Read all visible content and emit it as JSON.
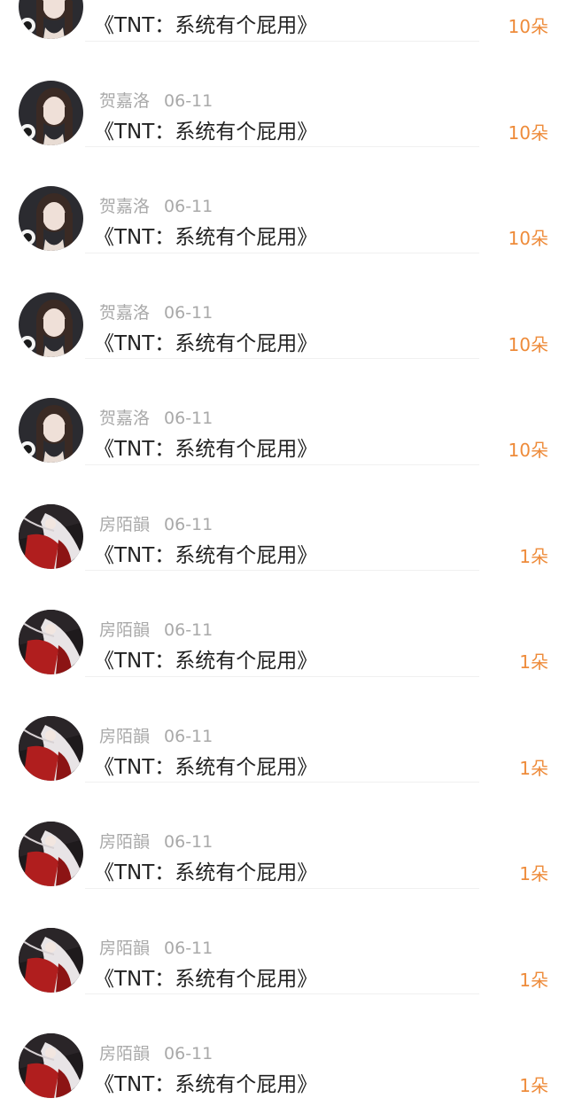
{
  "comments": [
    {
      "user": "",
      "date": "",
      "title": "《TNT：系统有个屁用》",
      "count": "10朵",
      "avatar": "girl-dark-hair-avatar"
    },
    {
      "user": "贺嘉洛",
      "date": "06-11",
      "title": "《TNT：系统有个屁用》",
      "count": "10朵",
      "avatar": "girl-dark-hair-avatar"
    },
    {
      "user": "贺嘉洛",
      "date": "06-11",
      "title": "《TNT：系统有个屁用》",
      "count": "10朵",
      "avatar": "girl-dark-hair-avatar"
    },
    {
      "user": "贺嘉洛",
      "date": "06-11",
      "title": "《TNT：系统有个屁用》",
      "count": "10朵",
      "avatar": "girl-dark-hair-avatar"
    },
    {
      "user": "贺嘉洛",
      "date": "06-11",
      "title": "《TNT：系统有个屁用》",
      "count": "10朵",
      "avatar": "girl-dark-hair-avatar"
    },
    {
      "user": "房陌韻",
      "date": "06-11",
      "title": "《TNT：系统有个屁用》",
      "count": "1朵",
      "avatar": "white-hair-red-robe-avatar"
    },
    {
      "user": "房陌韻",
      "date": "06-11",
      "title": "《TNT：系统有个屁用》",
      "count": "1朵",
      "avatar": "white-hair-red-robe-avatar"
    },
    {
      "user": "房陌韻",
      "date": "06-11",
      "title": "《TNT：系统有个屁用》",
      "count": "1朵",
      "avatar": "white-hair-red-robe-avatar"
    },
    {
      "user": "房陌韻",
      "date": "06-11",
      "title": "《TNT：系统有个屁用》",
      "count": "1朵",
      "avatar": "white-hair-red-robe-avatar"
    },
    {
      "user": "房陌韻",
      "date": "06-11",
      "title": "《TNT：系统有个屁用》",
      "count": "1朵",
      "avatar": "white-hair-red-robe-avatar"
    },
    {
      "user": "房陌韻",
      "date": "06-11",
      "title": "《TNT：系统有个屁用》",
      "count": "1朵",
      "avatar": "white-hair-red-robe-avatar"
    }
  ],
  "colors": {
    "count": "#ee8b3a",
    "username": "#a9a9a9",
    "title": "#222222",
    "divider": "#f0f0f0"
  }
}
